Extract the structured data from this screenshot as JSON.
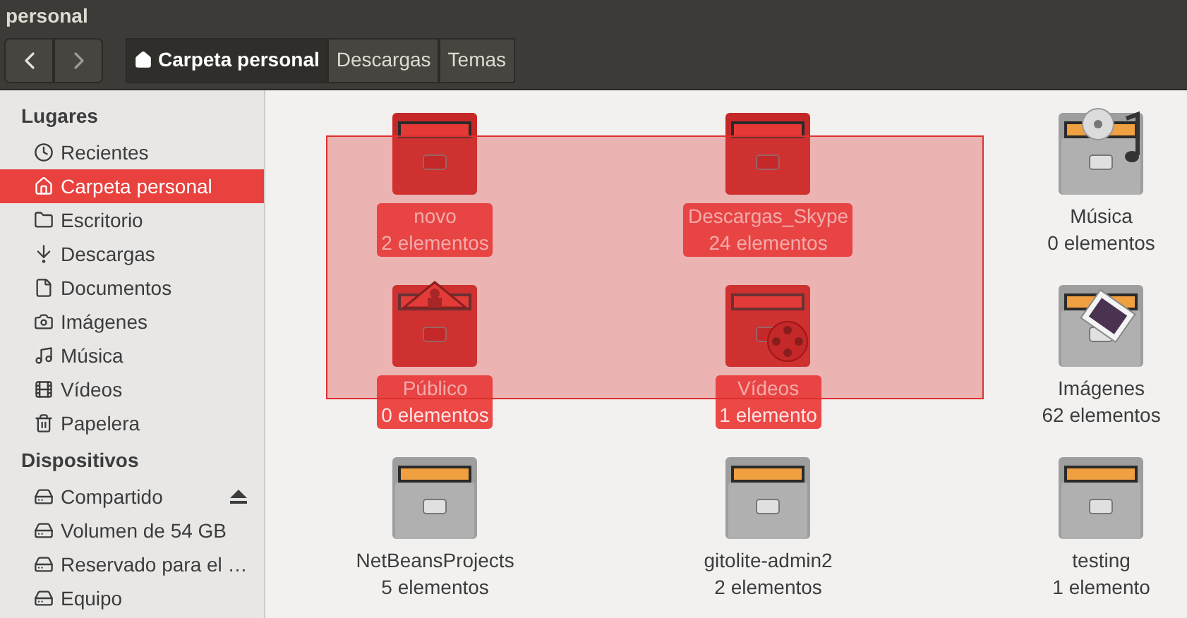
{
  "window": {
    "title": "personal"
  },
  "toolbar": {
    "path": [
      {
        "label": "Carpeta personal",
        "kind": "home",
        "selected": true
      },
      {
        "label": "Descargas",
        "kind": "plain",
        "selected": false
      },
      {
        "label": "Temas",
        "kind": "plain",
        "selected": false
      }
    ]
  },
  "sidebar": {
    "sections": [
      {
        "title": "Lugares",
        "items": [
          {
            "label": "Recientes",
            "kind": "recent",
            "selected": false
          },
          {
            "label": "Carpeta personal",
            "kind": "home",
            "selected": true
          },
          {
            "label": "Escritorio",
            "kind": "desktop",
            "selected": false
          },
          {
            "label": "Descargas",
            "kind": "download",
            "selected": false
          },
          {
            "label": "Documentos",
            "kind": "document",
            "selected": false
          },
          {
            "label": "Imágenes",
            "kind": "camera",
            "selected": false
          },
          {
            "label": "Música",
            "kind": "music",
            "selected": false
          },
          {
            "label": "Vídeos",
            "kind": "film",
            "selected": false
          },
          {
            "label": "Papelera",
            "kind": "trash",
            "selected": false
          }
        ]
      },
      {
        "title": "Dispositivos",
        "items": [
          {
            "label": "Compartido",
            "kind": "drive",
            "selected": false,
            "eject": true
          },
          {
            "label": "Volumen de 54 GB",
            "kind": "drive",
            "selected": false,
            "eject": false
          },
          {
            "label": "Reservado para el …",
            "kind": "drive",
            "selected": false,
            "eject": false
          },
          {
            "label": "Equipo",
            "kind": "drive",
            "selected": false,
            "eject": false
          }
        ]
      }
    ]
  },
  "files": [
    {
      "name": "novo",
      "count": "2 elementos",
      "kind": "plain",
      "selected": true
    },
    {
      "name": "Descargas_Skype",
      "count": "24 elementos",
      "kind": "plain",
      "selected": true
    },
    {
      "name": "Música",
      "count": "0 elementos",
      "kind": "music",
      "selected": false
    },
    {
      "name": "Público",
      "count": "0 elementos",
      "kind": "public",
      "selected": true
    },
    {
      "name": "Vídeos",
      "count": "1 elemento",
      "kind": "videos",
      "selected": true
    },
    {
      "name": "Imágenes",
      "count": "62 elementos",
      "kind": "pictures",
      "selected": false
    },
    {
      "name": "NetBeansProjects",
      "count": "5 elementos",
      "kind": "plain",
      "selected": false
    },
    {
      "name": "gitolite-admin2",
      "count": "2 elementos",
      "kind": "plain",
      "selected": false
    },
    {
      "name": "testing",
      "count": "1 elemento",
      "kind": "plain",
      "selected": false
    }
  ]
}
